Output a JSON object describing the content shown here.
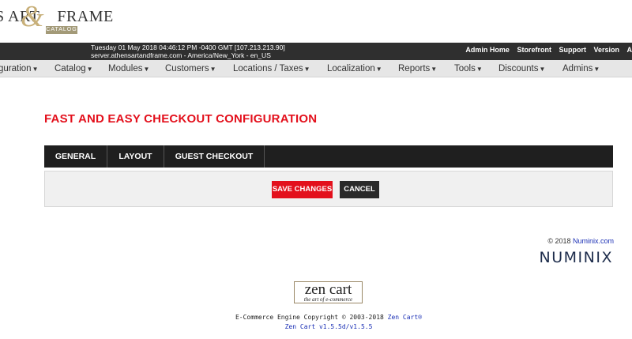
{
  "logo": {
    "brand_left": "S ART",
    "brand_right": "FRAME",
    "ampersand": "&",
    "sub": "CATALOG"
  },
  "header": {
    "datetime": "Tuesday 01 May 2018 04:46:12 PM -0400 GMT [107.213.213.90]",
    "server": "server.athensartandframe.com - America/New_York - en_US",
    "links": [
      "Admin Home",
      "Storefront",
      "Support",
      "Version",
      "A"
    ]
  },
  "menu": [
    {
      "label": "guration"
    },
    {
      "label": "Catalog"
    },
    {
      "label": "Modules"
    },
    {
      "label": "Customers"
    },
    {
      "label": "Locations / Taxes"
    },
    {
      "label": "Localization"
    },
    {
      "label": "Reports"
    },
    {
      "label": "Tools"
    },
    {
      "label": "Discounts"
    },
    {
      "label": "Admins"
    }
  ],
  "page": {
    "title": "FAST AND EASY CHECKOUT CONFIGURATION"
  },
  "tabs": [
    {
      "label": "GENERAL"
    },
    {
      "label": "LAYOUT"
    },
    {
      "label": "GUEST CHECKOUT"
    }
  ],
  "actions": {
    "save": "SAVE CHANGES",
    "cancel": "CANCEL"
  },
  "numinix": {
    "copyright": "© 2018",
    "link": "Numinix.com",
    "logo": "NUMINIX"
  },
  "zencart": {
    "logo": "zen cart",
    "tagline": "the art of e-commerce"
  },
  "footer": {
    "copyright": "E-Commerce Engine Copyright © 2003-2018",
    "link": "Zen Cart®",
    "version": "Zen Cart v1.5.5d/v1.5.5"
  },
  "colors": {
    "accent": "#e3101c",
    "dark": "#2f2f2f",
    "menu_bg": "#e6e6e6"
  }
}
